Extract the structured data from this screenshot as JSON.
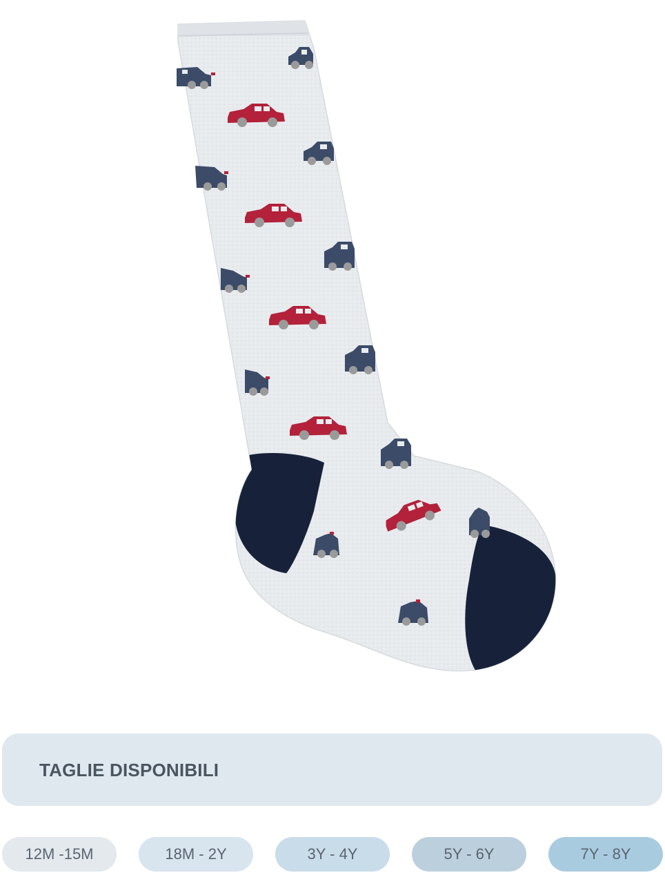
{
  "product": {
    "image_icon": "knee-high-sock-with-car-pattern",
    "colors": {
      "sock_body": "#e9ecef",
      "sock_heel_toe": "#17223a",
      "car_red": "#b3213a",
      "car_navy": "#3b4b68",
      "wheel_grey": "#9a9a9a"
    }
  },
  "sizes": {
    "title": "TAGLIE DISPONIBILI",
    "panel_color": "#dfe8ef",
    "options": [
      {
        "label": "12M -15M",
        "color": "#e4e9ee"
      },
      {
        "label": "18M - 2Y",
        "color": "#d8e4ee"
      },
      {
        "label": "3Y - 4Y",
        "color": "#c9dce9"
      },
      {
        "label": "5Y - 6Y",
        "color": "#bccfdc"
      },
      {
        "label": "7Y - 8Y",
        "color": "#a9cbe0"
      }
    ]
  }
}
